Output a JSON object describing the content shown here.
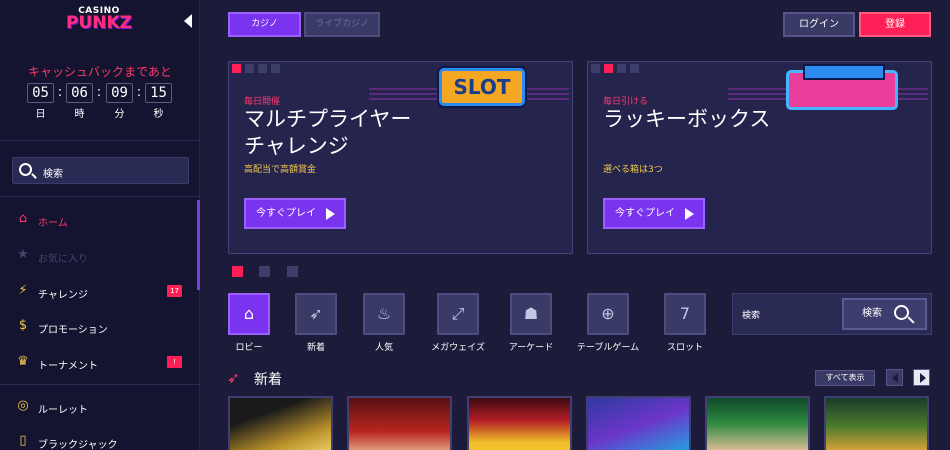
{
  "brand": {
    "line1": "CASINO",
    "line2": "PUNKZ"
  },
  "cashback": {
    "title": "キャッシュバックまであと",
    "days": "05",
    "hours": "06",
    "minutes": "09",
    "seconds": "15",
    "day_label": "日",
    "hour_label": "時",
    "minute_label": "分",
    "second_label": "秒"
  },
  "sidebar": {
    "search_placeholder": "検索",
    "items": [
      {
        "label": "ホーム",
        "icon": "home-icon",
        "badge": ""
      },
      {
        "label": "お気に入り",
        "icon": "star-icon",
        "badge": ""
      },
      {
        "label": "チャレンジ",
        "icon": "lightning-icon",
        "badge": "17"
      },
      {
        "label": "プロモーション",
        "icon": "dollar-icon",
        "badge": ""
      },
      {
        "label": "トーナメント",
        "icon": "trophy-icon",
        "badge": "!"
      },
      {
        "label": "ルーレット",
        "icon": "roulette-icon",
        "badge": ""
      },
      {
        "label": "ブラックジャック",
        "icon": "blackjack-icon",
        "badge": ""
      }
    ]
  },
  "header": {
    "tabs": [
      "カジノ",
      "ライブカジノ"
    ],
    "login": "ログイン",
    "register": "登録"
  },
  "promos": [
    {
      "sub": "毎日開催",
      "title": "マルチプライヤーチャレンジ",
      "desc": "高配当で高額賞金",
      "play": "今すぐプレイ",
      "sign": "SLOT"
    },
    {
      "sub": "毎日引ける",
      "title": "ラッキーボックス",
      "desc": "選べる箱は3つ",
      "play": "今すぐプレイ"
    }
  ],
  "categories": [
    {
      "label": "ロビー",
      "icon": "home-icon"
    },
    {
      "label": "新着",
      "icon": "rocket-icon"
    },
    {
      "label": "人気",
      "icon": "fire-icon"
    },
    {
      "label": "メガウェイズ",
      "icon": "expand-icon"
    },
    {
      "label": "アーケード",
      "icon": "invader-icon"
    },
    {
      "label": "テーブルゲーム",
      "icon": "chip-icon"
    },
    {
      "label": "スロット",
      "icon": "seven-icon"
    }
  ],
  "search": {
    "placeholder": "検索",
    "button": "検索"
  },
  "new_section": {
    "title": "新着",
    "show_all": "すべて表示"
  },
  "colors": {
    "accent": "#7a33ee",
    "pink": "#ff1f57",
    "bg": "#1c1b3a",
    "sidebar": "#141330"
  }
}
